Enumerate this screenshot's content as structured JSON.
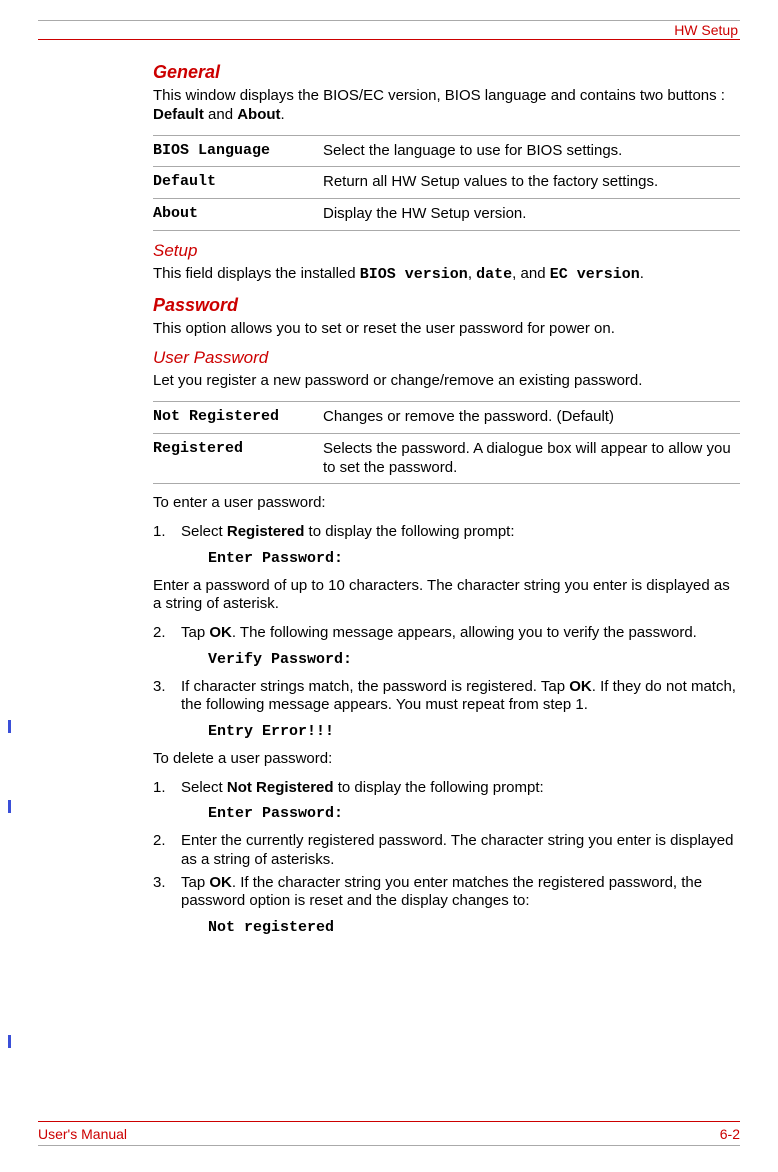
{
  "header": {
    "title": "HW Setup"
  },
  "sections": {
    "general": {
      "heading": "General",
      "intro_pre": "This window displays the BIOS/EC version, BIOS language and contains two buttons : ",
      "intro_b1": "Default",
      "intro_mid": " and ",
      "intro_b2": "About",
      "intro_post": ".",
      "table": [
        {
          "term": "BIOS Language",
          "desc": "Select the language to use for BIOS settings."
        },
        {
          "term": "Default",
          "desc": "Return all HW Setup values to the factory settings."
        },
        {
          "term": "About",
          "desc": "Display the HW Setup version."
        }
      ]
    },
    "setup": {
      "heading": "Setup",
      "pre": "This field displays the installed ",
      "m1": "BIOS version",
      "mid1": ", ",
      "m2": "date",
      "mid2": ", and ",
      "m3": "EC version",
      "post": "."
    },
    "password": {
      "heading": "Password",
      "intro": "This option allows you to set or reset the user password for power on."
    },
    "user_password": {
      "heading": "User Password",
      "intro": "Let you register a new password or change/remove an existing password.",
      "table": [
        {
          "term": "Not Registered",
          "desc": "Changes or remove the password. (Default)"
        },
        {
          "term": "Registered",
          "desc": "Selects the password. A dialogue box will appear to allow you to set the password."
        }
      ],
      "enter_intro": "To enter a user password:",
      "enter_steps": {
        "s1_pre": "Select ",
        "s1_b": "Registered",
        "s1_post": " to display the following prompt:",
        "s1_code": "Enter Password:",
        "after_s1": "Enter a password of up to 10 characters. The character string you enter is displayed as a string of asterisk.",
        "s2_pre": "Tap ",
        "s2_b": "OK",
        "s2_post": ". The following message appears, allowing you to verify the password.",
        "s2_code": "Verify Password:",
        "s3_pre": "If character strings match, the password is registered. Tap ",
        "s3_b": "OK",
        "s3_post": ". If they do not match, the following message appears. You must repeat from step 1.",
        "s3_code": "Entry Error!!!"
      },
      "delete_intro": "To delete a user password:",
      "delete_steps": {
        "s1_pre": "Select ",
        "s1_b": "Not Registered",
        "s1_post": " to display the following prompt:",
        "s1_code": "Enter Password:",
        "s2": "Enter the currently registered password. The character string you enter is displayed as a string of asterisks.",
        "s3_pre": "Tap ",
        "s3_b": "OK",
        "s3_post": ". If the character string you enter matches the registered password, the password option is reset and the display changes to:",
        "s3_code": "Not registered"
      }
    }
  },
  "footer": {
    "left": "User's Manual",
    "right": "6-2"
  }
}
